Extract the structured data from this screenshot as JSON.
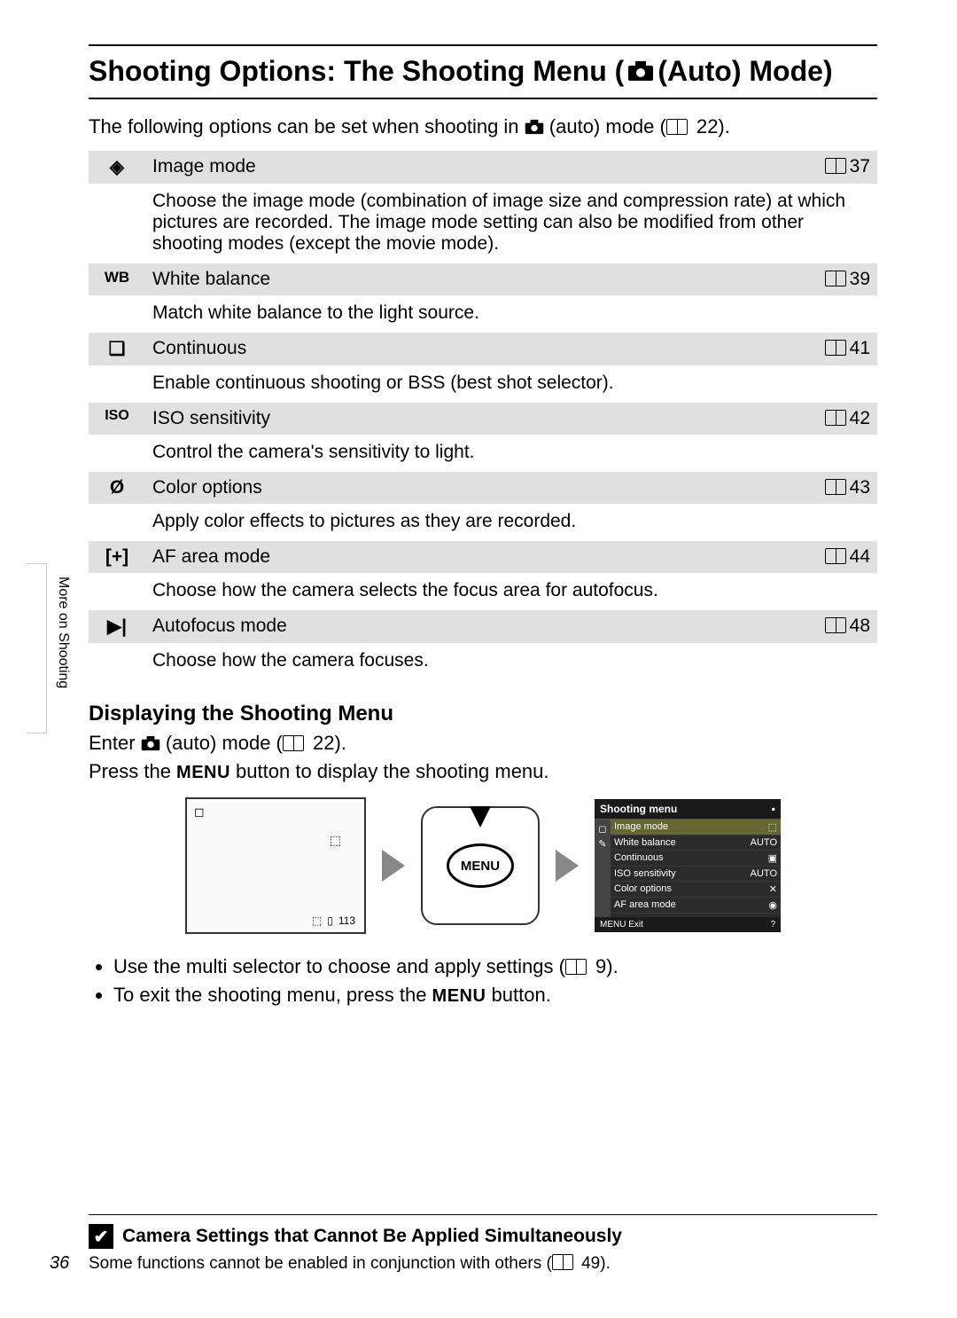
{
  "header": {
    "title_pre": "Shooting Options: The Shooting Menu (",
    "title_post": " (Auto) Mode)"
  },
  "intro": {
    "pre": "The following options can be set when shooting in ",
    "mid": " (auto) mode (",
    "page": " 22)."
  },
  "side_label": "More on Shooting",
  "options": [
    {
      "icon": "◈",
      "label": "Image mode",
      "page": "37",
      "desc": "Choose the image mode (combination of image size and compression rate) at which pictures are recorded. The image mode setting can also be modified from other shooting modes (except the movie mode)."
    },
    {
      "icon": "WB",
      "label": "White balance",
      "page": "39",
      "desc": "Match white balance to the light source."
    },
    {
      "icon": "❏",
      "label": "Continuous",
      "page": "41",
      "desc": "Enable continuous shooting or BSS (best shot selector)."
    },
    {
      "icon": "ISO",
      "label": "ISO sensitivity",
      "page": "42",
      "desc": "Control the camera's sensitivity to light."
    },
    {
      "icon": "Ø",
      "label": "Color options",
      "page": "43",
      "desc": "Apply color effects to pictures as they are recorded."
    },
    {
      "icon": "[+]",
      "label": "AF area mode",
      "page": "44",
      "desc": "Choose how the camera selects the focus area for autofocus."
    },
    {
      "icon": "▶|",
      "label": "Autofocus mode",
      "page": "48",
      "desc": "Choose how the camera focuses."
    }
  ],
  "display_section": {
    "heading": "Displaying the Shooting Menu",
    "line1_pre": "Enter ",
    "line1_mid": " (auto) mode (",
    "line1_page": " 22).",
    "line2_pre": "Press the ",
    "line2_menu": "MENU",
    "line2_post": " button to display the shooting menu."
  },
  "diagram": {
    "menu_button_label": "MENU",
    "screen1_counter": "113",
    "screen2": {
      "title": "Shooting menu",
      "items": [
        {
          "label": "Image mode",
          "val": "⬚"
        },
        {
          "label": "White balance",
          "val": "AUTO"
        },
        {
          "label": "Continuous",
          "val": "▣"
        },
        {
          "label": "ISO sensitivity",
          "val": "AUTO"
        },
        {
          "label": "Color options",
          "val": "✕"
        },
        {
          "label": "AF area mode",
          "val": "◉"
        }
      ],
      "footer_left": "MENU Exit",
      "footer_right": "?"
    }
  },
  "bullets": {
    "b1_pre": "Use the multi selector to choose and apply settings (",
    "b1_page": " 9).",
    "b2_pre": "To exit the shooting menu, press the ",
    "b2_menu": "MENU",
    "b2_post": " button."
  },
  "note": {
    "heading": "Camera Settings that Cannot Be Applied Simultaneously",
    "body_pre": "Some functions cannot be enabled in conjunction with others (",
    "body_page": " 49)."
  },
  "page_number": "36"
}
